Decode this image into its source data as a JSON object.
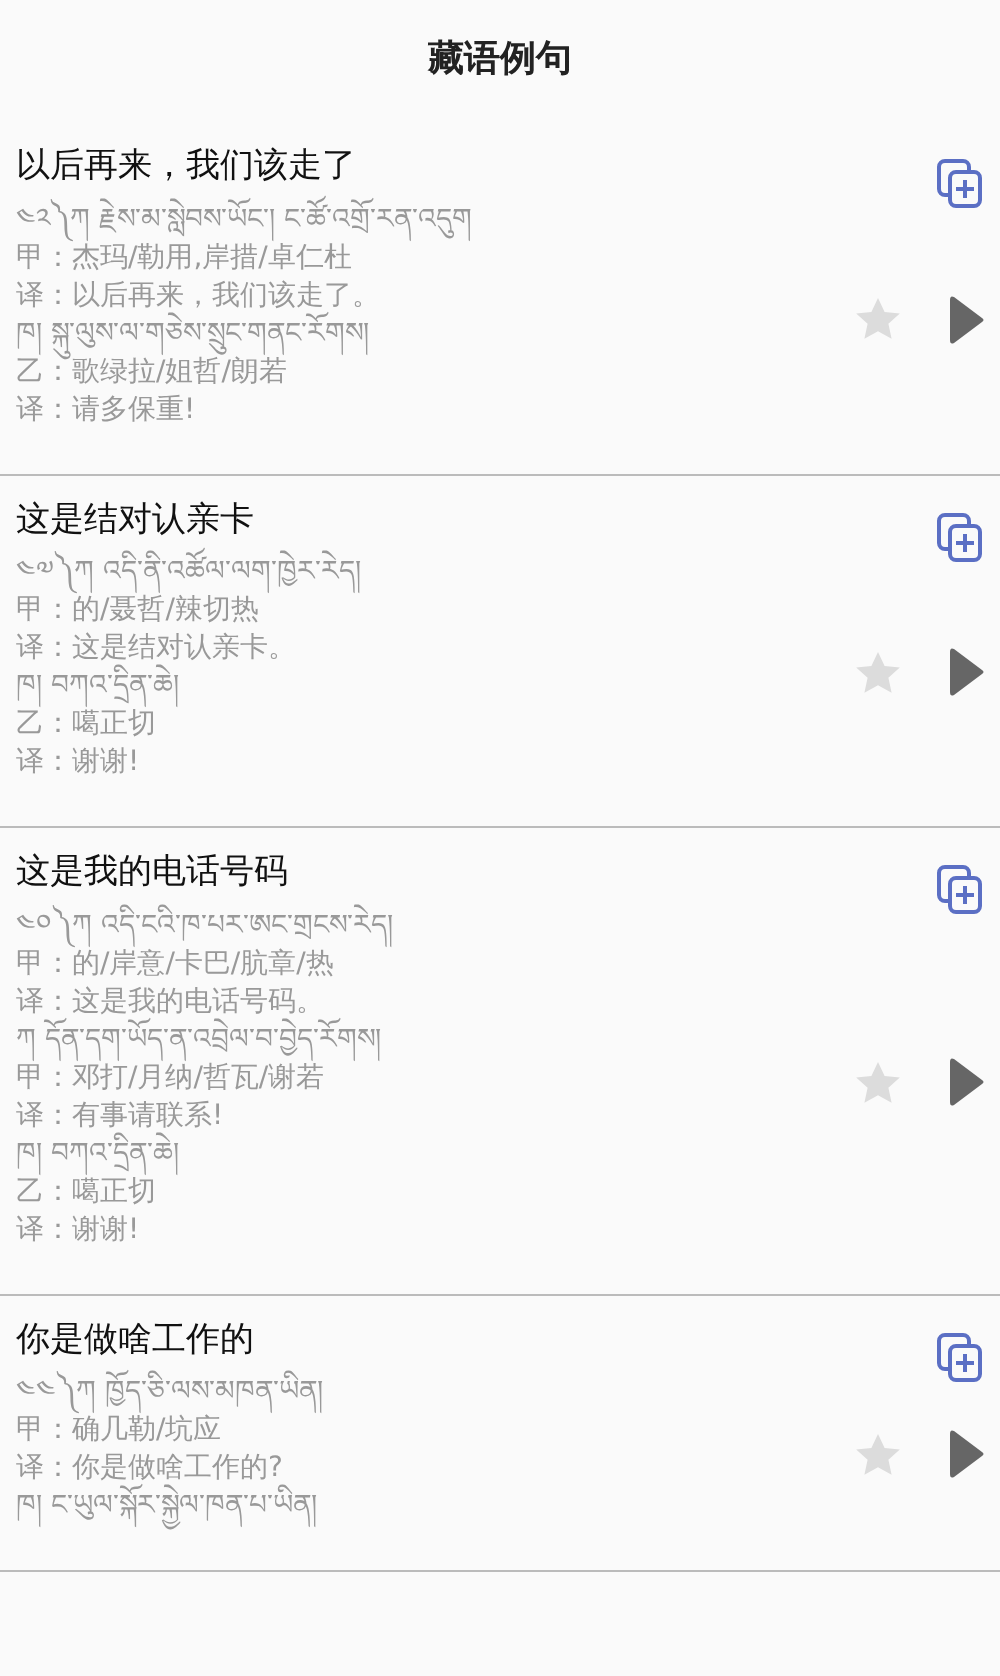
{
  "title": "藏语例句",
  "entries": [
    {
      "title": "以后再来，我们该走了",
      "favorite": false,
      "lines": [
        "༤༢༽ཀ  རྗེས་མ་སླེབས་ཡོང་།    ང་ཚོ་འགྲོ་རན་འདུག",
        "甲：杰玛/勒用,岸措/卓仁杜",
        "译：以后再来，我们该走了。",
        "ཁ།  སྐུ་ལུས་ལ་གཅེས་སྲུང་གནང་རོགས།",
        "乙：歌绿拉/姐哲/朗若",
        "译：请多保重!"
      ]
    },
    {
      "title": "这是结对认亲卡",
      "favorite": false,
      "lines": [
        "༤༧༽ཀ  འདི་ནི་འཚོལ་ལག་ཁྱེར་རེད།",
        "甲：的/聂哲/辣切热",
        "译：这是结对认亲卡。",
        "ཁ།  བཀའ་དྲིན་ཆེ།",
        "乙：噶正切",
        "译：谢谢!"
      ]
    },
    {
      "title": "这是我的电话号码",
      "favorite": false,
      "lines": [
        "༤༠༽ཀ  འདི་ངའི་ཁ་པར་ཨང་གྲངས་རེད།",
        "甲：的/岸意/卡巴/肮章/热",
        "译：这是我的电话号码。",
        "ཀ  དོན་དག་ཡོད་ན་འབྲེལ་བ་བྱེད་རོགས།",
        "甲：邓打/月纳/哲瓦/谢若",
        "译：有事请联系!",
        "ཁ།  བཀའ་དྲིན་ཆེ།",
        "乙：噶正切",
        "译：谢谢!"
      ]
    },
    {
      "title": "你是做啥工作的",
      "favorite": false,
      "lines": [
        "༤༤༽ཀ  ཁྱོད་ཅི་ལས་མཁན་ཡིན།",
        "甲：确几勒/坑应",
        "译：你是做啥工作的?",
        "ཁ།  ང་ཡུལ་སྐོར་སྐྱེལ་ཁན་པ་ཡིན།"
      ]
    }
  ]
}
